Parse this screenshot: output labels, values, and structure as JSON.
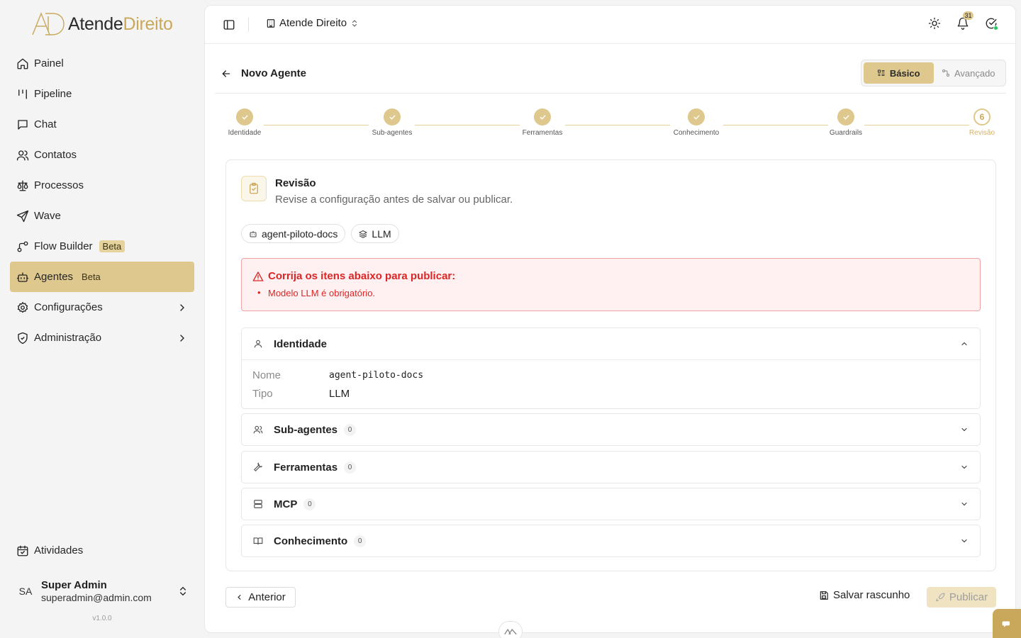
{
  "brand": {
    "name_part1": "Atende",
    "name_part2": "Direito",
    "colors": {
      "accent": "#dfc88d",
      "accent_dark": "#c9a85c",
      "error": "#dc2626",
      "success": "#22c55e"
    }
  },
  "sidebar": {
    "items": [
      {
        "label": "Painel",
        "icon": "home-icon"
      },
      {
        "label": "Pipeline",
        "icon": "kanban-icon"
      },
      {
        "label": "Chat",
        "icon": "message-icon"
      },
      {
        "label": "Contatos",
        "icon": "users-icon"
      },
      {
        "label": "Processos",
        "icon": "scale-icon"
      },
      {
        "label": "Wave",
        "icon": "send-icon"
      },
      {
        "label": "Flow Builder",
        "icon": "workflow-icon",
        "badge": "Beta"
      },
      {
        "label": "Agentes",
        "icon": "bot-icon",
        "badge": "Beta",
        "active": true
      },
      {
        "label": "Configurações",
        "icon": "gear-icon"
      },
      {
        "label": "Administração",
        "icon": "shield-icon"
      }
    ],
    "bottom_item": {
      "label": "Atividades",
      "icon": "calendar-icon"
    },
    "user": {
      "initials": "SA",
      "name": "Super Admin",
      "email": "superadmin@admin.com"
    },
    "version": "v1.0.0"
  },
  "topbar": {
    "org_name": "Atende Direito",
    "notification_count": "31"
  },
  "page": {
    "title": "Novo Agente",
    "modes": {
      "basic": "Básico",
      "advanced": "Avançado",
      "selected": "basic"
    }
  },
  "stepper": {
    "steps": [
      {
        "label": "Identidade",
        "state": "done"
      },
      {
        "label": "Sub-agentes",
        "state": "done"
      },
      {
        "label": "Ferramentas",
        "state": "done"
      },
      {
        "label": "Conhecimento",
        "state": "done"
      },
      {
        "label": "Guardrails",
        "state": "done"
      },
      {
        "label": "Revisão",
        "state": "current",
        "number": "6"
      }
    ]
  },
  "review": {
    "title": "Revisão",
    "subtitle": "Revise a configuração antes de salvar ou publicar.",
    "chips": [
      {
        "label": "agent-piloto-docs",
        "icon": "bot-icon"
      },
      {
        "label": "LLM",
        "icon": "layers-icon"
      }
    ],
    "alert": {
      "title": "Corrija os itens abaixo para publicar:",
      "items": [
        "Modelo LLM é obrigatório."
      ]
    },
    "sections": {
      "identity": {
        "title": "Identidade",
        "fields": [
          {
            "key": "Nome",
            "value": "agent-piloto-docs"
          },
          {
            "key": "Tipo",
            "value": "LLM"
          }
        ]
      },
      "subagents": {
        "title": "Sub-agentes",
        "count": "0"
      },
      "tools": {
        "title": "Ferramentas",
        "count": "0"
      },
      "mcp": {
        "title": "MCP",
        "count": "0"
      },
      "knowledge": {
        "title": "Conhecimento",
        "count": "0"
      }
    }
  },
  "footer": {
    "prev": "Anterior",
    "draft": "Salvar rascunho",
    "publish": "Publicar"
  }
}
